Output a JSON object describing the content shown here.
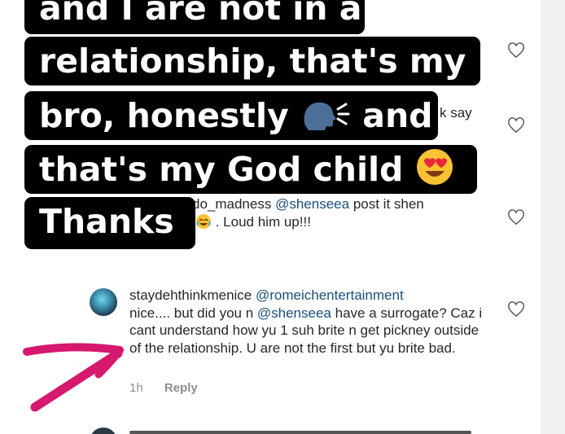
{
  "caption": {
    "line1": "and I are not in a",
    "line2": "relationship, that's my",
    "line3": "bro, honestly",
    "line3b": "and",
    "line4": "that's my God child",
    "line5": "Thanks"
  },
  "background_comments": {
    "fragment_say": "k say",
    "comment2_user_fragment": "do_madness",
    "comment2_mention": "@shenseea",
    "comment2_text_a": "post it shen",
    "comment2_text_b": ". Loud him up!!!"
  },
  "comment": {
    "username": "staydehthinkmenice",
    "mention1": "@romeichentertainment",
    "text1": "nice.... but did you n",
    "mention2": "@shenseea",
    "text2": "have a surrogate? Caz i cant understand how yu 1 suh brite n get pickney outside of the relationship. U are not the first but yu brite bad.",
    "time": "1h",
    "reply_label": "Reply"
  },
  "icons": [
    "heart-outline-icon",
    "speaking-head-emoji",
    "heart-eyes-emoji",
    "face-with-tears-of-joy-emoji",
    "pink-arrow"
  ],
  "colors": {
    "caption_bg": "#000000",
    "caption_text": "#ffffff",
    "mention": "#1a4f7a",
    "meta": "#8e8e8e",
    "arrow": "#d6186e"
  }
}
